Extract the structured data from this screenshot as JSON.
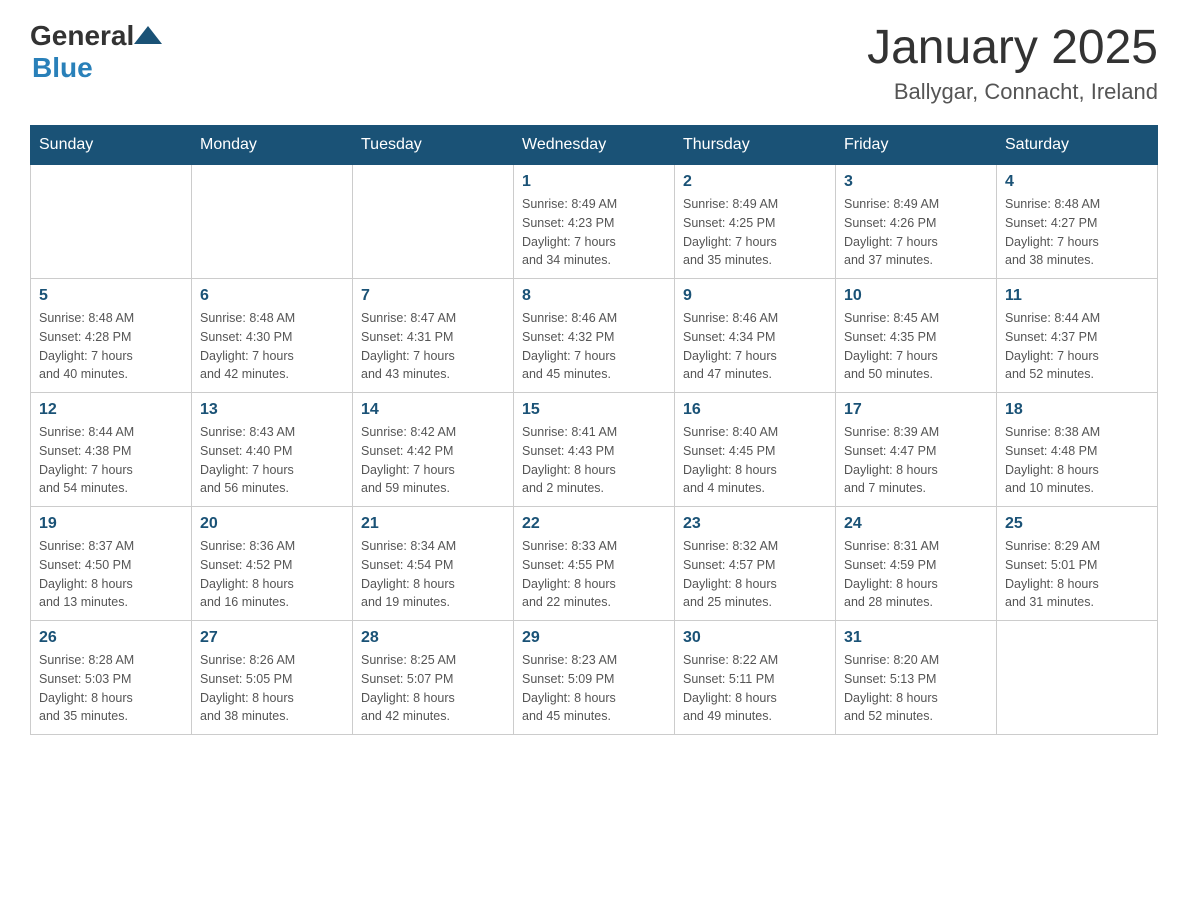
{
  "logo": {
    "general": "General",
    "blue": "Blue"
  },
  "title": "January 2025",
  "subtitle": "Ballygar, Connacht, Ireland",
  "headers": [
    "Sunday",
    "Monday",
    "Tuesday",
    "Wednesday",
    "Thursday",
    "Friday",
    "Saturday"
  ],
  "weeks": [
    [
      {
        "day": "",
        "info": ""
      },
      {
        "day": "",
        "info": ""
      },
      {
        "day": "",
        "info": ""
      },
      {
        "day": "1",
        "info": "Sunrise: 8:49 AM\nSunset: 4:23 PM\nDaylight: 7 hours\nand 34 minutes."
      },
      {
        "day": "2",
        "info": "Sunrise: 8:49 AM\nSunset: 4:25 PM\nDaylight: 7 hours\nand 35 minutes."
      },
      {
        "day": "3",
        "info": "Sunrise: 8:49 AM\nSunset: 4:26 PM\nDaylight: 7 hours\nand 37 minutes."
      },
      {
        "day": "4",
        "info": "Sunrise: 8:48 AM\nSunset: 4:27 PM\nDaylight: 7 hours\nand 38 minutes."
      }
    ],
    [
      {
        "day": "5",
        "info": "Sunrise: 8:48 AM\nSunset: 4:28 PM\nDaylight: 7 hours\nand 40 minutes."
      },
      {
        "day": "6",
        "info": "Sunrise: 8:48 AM\nSunset: 4:30 PM\nDaylight: 7 hours\nand 42 minutes."
      },
      {
        "day": "7",
        "info": "Sunrise: 8:47 AM\nSunset: 4:31 PM\nDaylight: 7 hours\nand 43 minutes."
      },
      {
        "day": "8",
        "info": "Sunrise: 8:46 AM\nSunset: 4:32 PM\nDaylight: 7 hours\nand 45 minutes."
      },
      {
        "day": "9",
        "info": "Sunrise: 8:46 AM\nSunset: 4:34 PM\nDaylight: 7 hours\nand 47 minutes."
      },
      {
        "day": "10",
        "info": "Sunrise: 8:45 AM\nSunset: 4:35 PM\nDaylight: 7 hours\nand 50 minutes."
      },
      {
        "day": "11",
        "info": "Sunrise: 8:44 AM\nSunset: 4:37 PM\nDaylight: 7 hours\nand 52 minutes."
      }
    ],
    [
      {
        "day": "12",
        "info": "Sunrise: 8:44 AM\nSunset: 4:38 PM\nDaylight: 7 hours\nand 54 minutes."
      },
      {
        "day": "13",
        "info": "Sunrise: 8:43 AM\nSunset: 4:40 PM\nDaylight: 7 hours\nand 56 minutes."
      },
      {
        "day": "14",
        "info": "Sunrise: 8:42 AM\nSunset: 4:42 PM\nDaylight: 7 hours\nand 59 minutes."
      },
      {
        "day": "15",
        "info": "Sunrise: 8:41 AM\nSunset: 4:43 PM\nDaylight: 8 hours\nand 2 minutes."
      },
      {
        "day": "16",
        "info": "Sunrise: 8:40 AM\nSunset: 4:45 PM\nDaylight: 8 hours\nand 4 minutes."
      },
      {
        "day": "17",
        "info": "Sunrise: 8:39 AM\nSunset: 4:47 PM\nDaylight: 8 hours\nand 7 minutes."
      },
      {
        "day": "18",
        "info": "Sunrise: 8:38 AM\nSunset: 4:48 PM\nDaylight: 8 hours\nand 10 minutes."
      }
    ],
    [
      {
        "day": "19",
        "info": "Sunrise: 8:37 AM\nSunset: 4:50 PM\nDaylight: 8 hours\nand 13 minutes."
      },
      {
        "day": "20",
        "info": "Sunrise: 8:36 AM\nSunset: 4:52 PM\nDaylight: 8 hours\nand 16 minutes."
      },
      {
        "day": "21",
        "info": "Sunrise: 8:34 AM\nSunset: 4:54 PM\nDaylight: 8 hours\nand 19 minutes."
      },
      {
        "day": "22",
        "info": "Sunrise: 8:33 AM\nSunset: 4:55 PM\nDaylight: 8 hours\nand 22 minutes."
      },
      {
        "day": "23",
        "info": "Sunrise: 8:32 AM\nSunset: 4:57 PM\nDaylight: 8 hours\nand 25 minutes."
      },
      {
        "day": "24",
        "info": "Sunrise: 8:31 AM\nSunset: 4:59 PM\nDaylight: 8 hours\nand 28 minutes."
      },
      {
        "day": "25",
        "info": "Sunrise: 8:29 AM\nSunset: 5:01 PM\nDaylight: 8 hours\nand 31 minutes."
      }
    ],
    [
      {
        "day": "26",
        "info": "Sunrise: 8:28 AM\nSunset: 5:03 PM\nDaylight: 8 hours\nand 35 minutes."
      },
      {
        "day": "27",
        "info": "Sunrise: 8:26 AM\nSunset: 5:05 PM\nDaylight: 8 hours\nand 38 minutes."
      },
      {
        "day": "28",
        "info": "Sunrise: 8:25 AM\nSunset: 5:07 PM\nDaylight: 8 hours\nand 42 minutes."
      },
      {
        "day": "29",
        "info": "Sunrise: 8:23 AM\nSunset: 5:09 PM\nDaylight: 8 hours\nand 45 minutes."
      },
      {
        "day": "30",
        "info": "Sunrise: 8:22 AM\nSunset: 5:11 PM\nDaylight: 8 hours\nand 49 minutes."
      },
      {
        "day": "31",
        "info": "Sunrise: 8:20 AM\nSunset: 5:13 PM\nDaylight: 8 hours\nand 52 minutes."
      },
      {
        "day": "",
        "info": ""
      }
    ]
  ]
}
